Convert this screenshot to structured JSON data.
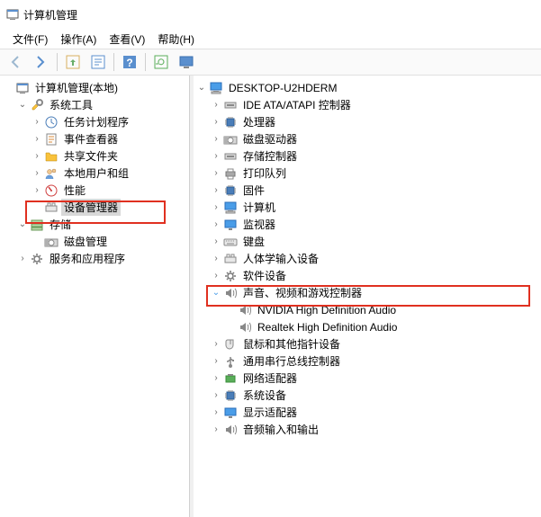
{
  "title": "计算机管理",
  "menus": {
    "file": "文件(F)",
    "action": "操作(A)",
    "view": "查看(V)",
    "help": "帮助(H)"
  },
  "left": {
    "root": "计算机管理(本地)",
    "systools": "系统工具",
    "task": "任务计划程序",
    "event": "事件查看器",
    "shared": "共享文件夹",
    "users": "本地用户和组",
    "perf": "性能",
    "devmgr": "设备管理器",
    "storage": "存储",
    "diskmgmt": "磁盘管理",
    "services": "服务和应用程序"
  },
  "right": {
    "host": "DESKTOP-U2HDERM",
    "ide": "IDE ATA/ATAPI 控制器",
    "cpu": "处理器",
    "diskdrv": "磁盘驱动器",
    "storctrl": "存储控制器",
    "printq": "打印队列",
    "firmware": "固件",
    "computer": "计算机",
    "monitor": "监视器",
    "keyboard": "键盘",
    "hid": "人体学输入设备",
    "software": "软件设备",
    "sound": "声音、视频和游戏控制器",
    "nvidia": "NVIDIA High Definition Audio",
    "realtek": "Realtek High Definition Audio",
    "mouse": "鼠标和其他指针设备",
    "usb": "通用串行总线控制器",
    "network": "网络适配器",
    "sysdev": "系统设备",
    "display": "显示适配器",
    "audioio": "音频输入和输出"
  }
}
